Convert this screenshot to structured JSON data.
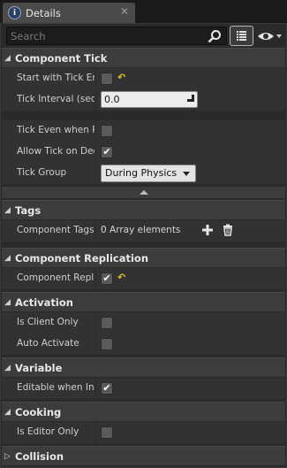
{
  "tab": {
    "label": "Details",
    "icon": "info-icon",
    "close": "✕"
  },
  "search": {
    "placeholder": "Search"
  },
  "sections": {
    "component_tick": {
      "title": "Component Tick",
      "start_with_tick_enabled": {
        "label": "Start with Tick Enabled",
        "checked": false,
        "reset_icon": "↶"
      },
      "tick_interval": {
        "label": "Tick Interval (secs)",
        "value": "0.0"
      },
      "tick_even_when_paused": {
        "label": "Tick Even when Paused",
        "checked": false
      },
      "allow_tick_on_dedicated_server": {
        "label": "Allow Tick on Dedicated Server",
        "checked": true
      },
      "tick_group": {
        "label": "Tick Group",
        "value": "During Physics"
      }
    },
    "tags": {
      "title": "Tags",
      "component_tags": {
        "label": "Component Tags",
        "value": "0 Array elements"
      }
    },
    "component_replication": {
      "title": "Component Replication",
      "component_replicates": {
        "label": "Component Replicates",
        "checked": true,
        "reset_icon": "↶"
      }
    },
    "activation": {
      "title": "Activation",
      "is_client_only": {
        "label": "Is Client Only",
        "checked": false
      },
      "auto_activate": {
        "label": "Auto Activate",
        "checked": false
      }
    },
    "variable": {
      "title": "Variable",
      "editable_when_inherited": {
        "label": "Editable when Inherited",
        "checked": true
      }
    },
    "cooking": {
      "title": "Cooking",
      "is_editor_only": {
        "label": "Is Editor Only",
        "checked": false
      }
    },
    "collision": {
      "title": "Collision"
    }
  },
  "icons": {
    "check": "✔",
    "expanded": "◢",
    "collapsed": "▷"
  },
  "colors": {
    "panel_bg": "#2a2a2a",
    "header_bg": "#3c3c3c",
    "row_bg": "#323232",
    "reset_arrow": "#e3c41b"
  }
}
